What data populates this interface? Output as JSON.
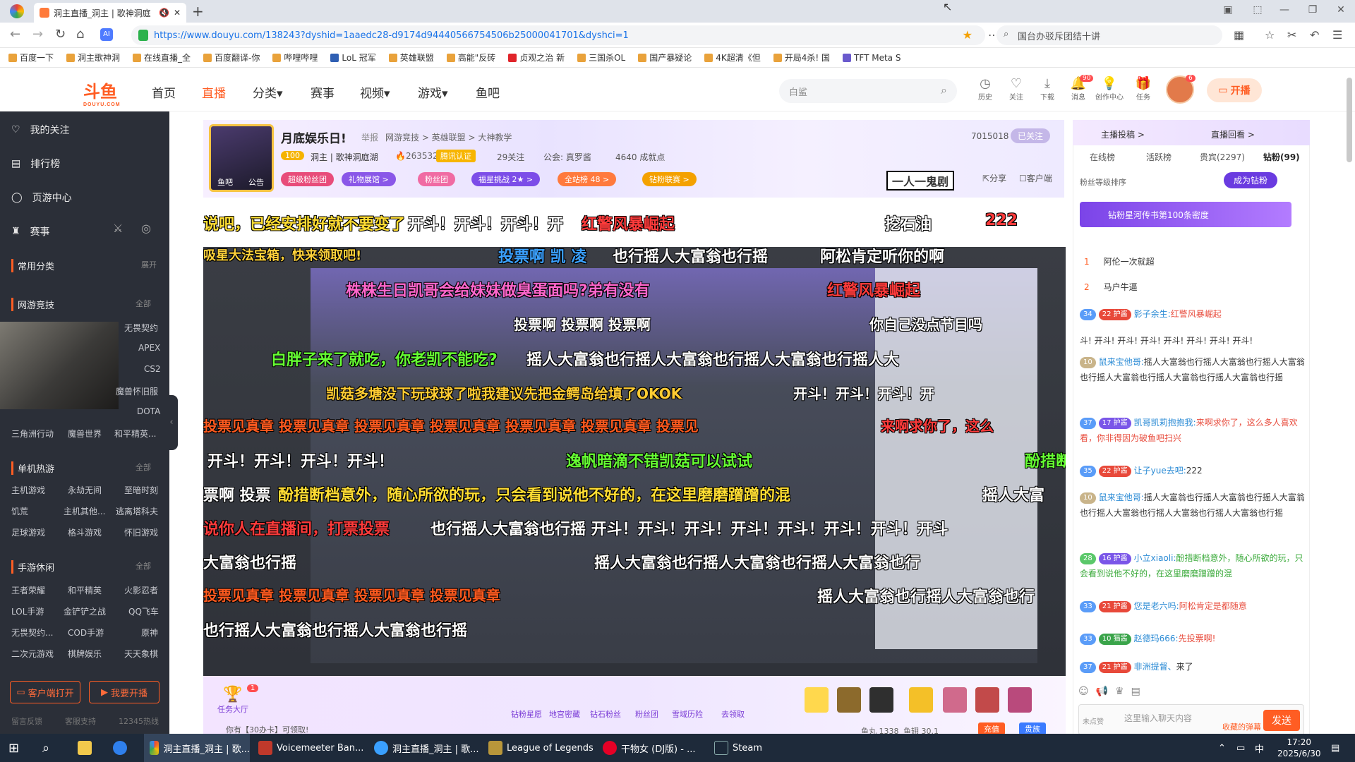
{
  "browser": {
    "tab_title": "洞主直播_洞主 | 歌神洞庭",
    "url": "https://www.douyu.com/138243?dyshid=1aaedc28-d9174d9444056675450​6b25000041701&dyshci=1",
    "search_text": "国台办驳斥团结十讲",
    "bookmarks": [
      "百度一下",
      "洞主歌神洞",
      "在线直播_全",
      "百度翻译-你",
      "哔哩哔哩",
      "LoL 冠军",
      "英雄联盟",
      "高能\"反砖",
      "贞观之治 新",
      "三国杀OL",
      "国产暴疑论",
      "4K超清《但",
      "开局4杀! 国",
      "TFT Meta S"
    ]
  },
  "site": {
    "logo": "斗鱼",
    "logo_sub": "DOUYU.COM",
    "nav": [
      "首页",
      "直播",
      "分类▾",
      "赛事",
      "视频▾",
      "游戏▾",
      "鱼吧"
    ],
    "search_placeholder": "白鲨",
    "header_icons": [
      {
        "name": "历史",
        "icon": "clock-icon"
      },
      {
        "name": "关注",
        "icon": "heart-icon"
      },
      {
        "name": "下载",
        "icon": "download-icon"
      },
      {
        "name": "消息",
        "icon": "bell-icon"
      },
      {
        "name": "创作中心",
        "icon": "bulb-icon"
      },
      {
        "name": "任务",
        "icon": "gift-icon"
      }
    ],
    "message_count": "90",
    "avatar_count": "6",
    "kaibo_label": "开播"
  },
  "sidebar": {
    "items": [
      "我的关注",
      "排行榜",
      "页游中心",
      "赛事"
    ],
    "sections": [
      {
        "title": "常用分类",
        "more": "展开",
        "games": []
      },
      {
        "title": "网游竞技",
        "more": "全部",
        "games": [
          "无畏契约",
          "APEX",
          "CS2",
          "魔兽怀旧服",
          "DOTA",
          "三角洲行动",
          "魔兽世界",
          "和平精英..."
        ]
      },
      {
        "title": "单机热游",
        "more": "全部",
        "games": [
          "主机游戏",
          "永劫无间",
          "至暗时刻",
          "饥荒",
          "主机其他...",
          "逃离塔科夫",
          "足球游戏",
          "格斗游戏",
          "怀旧游戏"
        ]
      },
      {
        "title": "手游休闲",
        "more": "全部",
        "games": [
          "王者荣耀",
          "和平精英",
          "火影忍者",
          "LOL手游",
          "金铲铲之战",
          "QQ飞车",
          "无畏契约...",
          "COD手游",
          "原神",
          "二次元游戏",
          "棋牌娱乐",
          "天天象棋"
        ]
      }
    ],
    "client_btn": "客户端打开",
    "start_btn": "我要开播",
    "footer_links": [
      "留言反馈",
      "客服支持",
      "12345热线"
    ]
  },
  "room": {
    "title": "月底娱乐日!",
    "report": "举报",
    "category": "网游竞技 > 英雄联盟 > 大神教学",
    "anchor_level": "100",
    "anchor_name": "洞主 | 歌神洞庭湖",
    "hot": "2635324",
    "verify": "腾讯认证",
    "fans": "29关注",
    "guild": "公会: 真罗酱",
    "count": "4640 成就点",
    "room_id": "7015018",
    "follow": "已关注",
    "anchor_tags": [
      "鱼吧",
      "公告"
    ],
    "tags": [
      "超级粉丝团",
      "礼物展馆 >",
      "粉丝团",
      "福星挑战 2★ >",
      "全站榜 48 >",
      "钻粉联赛 >"
    ],
    "share": "分享",
    "client": "客户端",
    "signature": "一人一鬼剧"
  },
  "danmaku": [
    {
      "text": "说吧，已经安排好就不要变了",
      "color": "#ffdd33"
    },
    {
      "text": "开斗！开斗！开斗！开",
      "color": "#ffffff"
    },
    {
      "text": "红警风暴崛起",
      "color": "#ff3b3b"
    },
    {
      "text": "挖石油",
      "color": "#ffffff"
    },
    {
      "text": "222",
      "color": "#ff3b3b"
    },
    {
      "text": "吸星大法宝箱，快来领取吧!",
      "color": "#ffd23b"
    },
    {
      "text": "投票啊 凯 凌",
      "color": "#3ba1ff"
    },
    {
      "text": "也行摇人大富翁也行摇",
      "color": "#ffffff"
    },
    {
      "text": "阿松肯定听你的啊",
      "color": "#ffffff"
    },
    {
      "text": "株株生日凯哥会给妹妹做臭蛋面吗?弟有没有",
      "color": "#ff66cc"
    },
    {
      "text": "红警风暴崛起",
      "color": "#ff3b3b"
    },
    {
      "text": "投票啊 投票啊 投票啊",
      "color": "#ffffff"
    },
    {
      "text": "你自己没点节目吗",
      "color": "#ffffff"
    },
    {
      "text": "白胖子来了就吃，你老凯不能吃?",
      "color": "#66ff33"
    },
    {
      "text": "摇人大富翁也行摇人大富翁也行摇人大富翁也行摇人大",
      "color": "#ffffff"
    },
    {
      "text": "凯菇多塘没下玩球球了啦我建议先把金鳄岛给填了OKOK",
      "color": "#ffcc33"
    },
    {
      "text": "开斗！开斗！开斗！开",
      "color": "#ffffff"
    },
    {
      "text": "投票见真章 投票见真章 投票见真章 投票见真章 投票见真章 投票见真章 投票见",
      "color": "#ff5a1f"
    },
    {
      "text": "来啊求你了，这么",
      "color": "#ff3b3b"
    },
    {
      "text": "开斗！开斗！开斗！开斗！",
      "color": "#ffffff"
    },
    {
      "text": "逸帆暗滴不错凯菇可以试试",
      "color": "#66ff33"
    },
    {
      "text": "酚措断",
      "color": "#66ff33"
    },
    {
      "text": "票啊 投票",
      "color": "#ffffff"
    },
    {
      "text": "酚措断档意外，随心所欲的玩，只会看到说他不好的，在这里磨磨蹭蹭的混",
      "color": "#ffdd33"
    },
    {
      "text": "摇人大富",
      "color": "#ffffff"
    },
    {
      "text": "说你人在直播间，打票投票",
      "color": "#ff3b3b"
    },
    {
      "text": "也行摇人大富翁也行摇 开斗！开斗！开斗！开斗！开斗！开斗！开斗！开斗",
      "color": "#ffffff"
    },
    {
      "text": "大富翁也行摇",
      "color": "#ffffff"
    },
    {
      "text": "摇人大富翁也行摇人大富翁也行摇人大富翁也行",
      "color": "#ffffff"
    },
    {
      "text": "投票见真章 投票见真章 投票见真章 投票见真章",
      "color": "#ff5a1f"
    },
    {
      "text": "摇人大富翁也行摇人大富翁也行",
      "color": "#ffffff"
    },
    {
      "text": "也行摇人大富翁也行摇人大富翁也行摇",
      "color": "#ffffff"
    }
  ],
  "gamebar": {
    "task": "任务大厅",
    "task_badge": "1",
    "items": [
      "钻粉星愿",
      "地宫密藏",
      "钻石粉丝",
      "粉丝团",
      "雪域历险",
      "去领取"
    ],
    "notice": "你有【30办卡】可领取!",
    "fish_pole": "鱼丸 1338",
    "fish_ball": "鱼翅 30.1",
    "recharge": "充值",
    "vip": "贵族"
  },
  "chat": {
    "banner_left": "主播投稿 >",
    "banner_right": "直播回看 >",
    "tabs": [
      "在线榜",
      "活跃榜",
      "贵宾(2297)",
      "钻粉(99)"
    ],
    "fans_sort": "粉丝等级排序",
    "join_btn": "成为钻粉",
    "promo": "钻粉星河传书第100条密度",
    "rank": [
      {
        "no": "1",
        "name": "阿伦一次就超"
      },
      {
        "no": "2",
        "name": "马户牛逼"
      }
    ],
    "messages": [
      {
        "lv": "34",
        "badge": "22 护酱",
        "nick": "影子余生:",
        "text": "红警风暴崛起"
      },
      {
        "lv": "",
        "badge": "",
        "nick": "",
        "text": "斗! 开斗! 开斗! 开斗! 开斗! 开斗! 开斗! 开斗!"
      },
      {
        "lv": "10",
        "badge": "",
        "nick": "鼠来宝他哥:",
        "text": "摇人大富翁也行摇人大富翁也行摇人大富翁也行摇人大富翁也行摇人大富翁也行摇人大富翁也行摇"
      },
      {
        "lv": "37",
        "badge": "17 护酱",
        "nick": "凯哥凯莉抱抱我:",
        "text": "来啊求你了，这么多人喜欢看，你非得因为破鱼吧扫兴"
      },
      {
        "lv": "35",
        "badge": "22 护酱",
        "nick": "让子yue去吧:",
        "text": "222"
      },
      {
        "lv": "10",
        "badge": "",
        "nick": "鼠来宝他哥:",
        "text": "摇人大富翁也行摇人大富翁也行摇人大富翁也行摇人大富翁也行摇人大富翁也行摇人大富翁也行摇"
      },
      {
        "lv": "28",
        "badge": "16 护酱",
        "nick": "小立xiaoli:",
        "text": "酚措断档意外，随心所欲的玩，只会看到说他不好的，在这里磨磨蹭蹭的混"
      },
      {
        "lv": "33",
        "badge": "21 护酱",
        "nick": "您是老六吗:",
        "text": "阿松肯定是都随意"
      },
      {
        "lv": "33",
        "badge": "10 猫酱",
        "nick": "赵德玛666:",
        "text": "先投票啊!"
      },
      {
        "lv": "37",
        "badge": "21 护酱",
        "nick": "非洲提督、",
        "text": "来了"
      }
    ],
    "input_placeholder": "这里输入聊天内容",
    "send": "发送",
    "unfollow": "未点赞",
    "collect": "收藏的弹幕"
  },
  "taskbar": {
    "apps": [
      "洞主直播_洞主 | 歌...",
      "Voicemeeter Ban...",
      "洞主直播_洞主 | 歌...",
      "League of Legends",
      "干物女 (DJ版) - ...",
      "Steam"
    ],
    "time": "17:20",
    "date": "2025/6/30",
    "ime": "中"
  }
}
